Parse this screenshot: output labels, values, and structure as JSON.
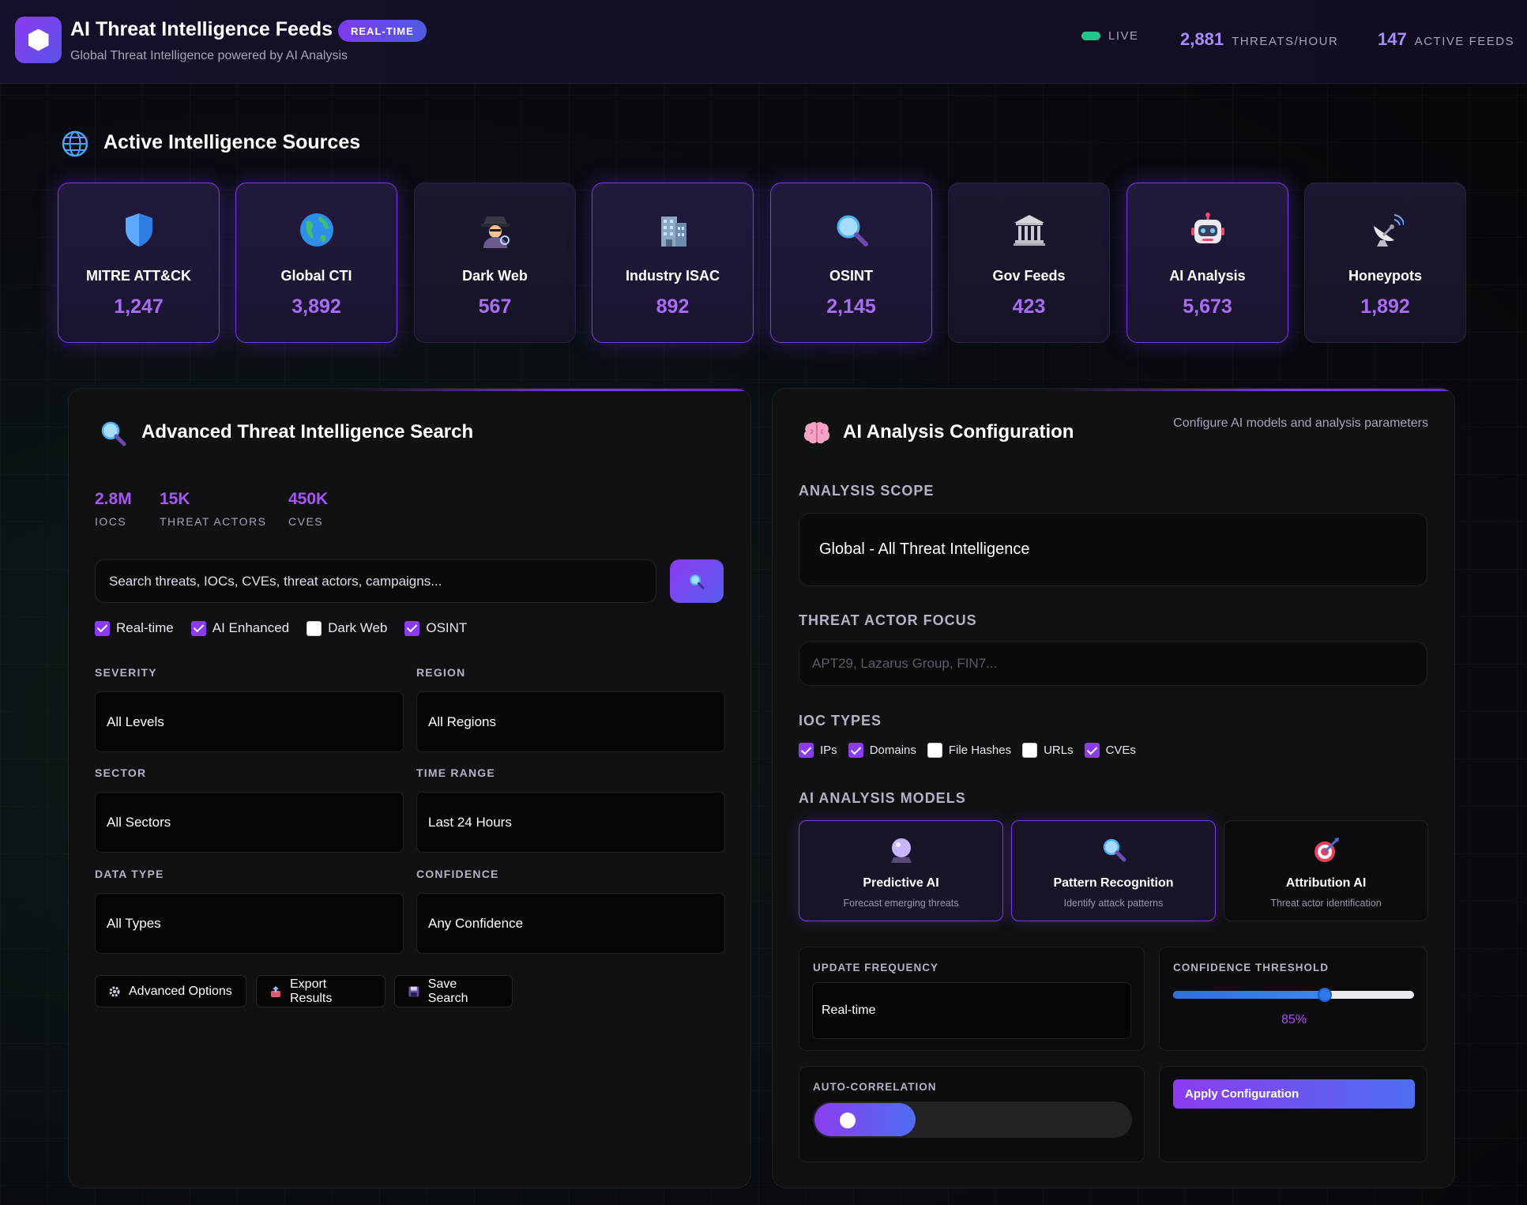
{
  "header": {
    "title": "AI Threat Intelligence Feeds",
    "badge": "REAL-TIME",
    "subtitle": "Global Threat Intelligence powered by AI Analysis",
    "live_label": "LIVE",
    "threats_value": "2,881",
    "threats_label": "THREATS/HOUR",
    "feeds_value": "147",
    "feeds_label": "ACTIVE FEEDS"
  },
  "sources": {
    "title": "Active Intelligence Sources",
    "items": [
      {
        "name": "MITRE ATT&CK",
        "value": "1,247",
        "icon": "shield-icon",
        "active": true
      },
      {
        "name": "Global CTI",
        "value": "3,892",
        "icon": "globe-icon",
        "active": true
      },
      {
        "name": "Dark Web",
        "value": "567",
        "icon": "detective-icon",
        "active": false
      },
      {
        "name": "Industry ISAC",
        "value": "892",
        "icon": "office-building-icon",
        "active": true
      },
      {
        "name": "OSINT",
        "value": "2,145",
        "icon": "magnifier-icon",
        "active": true
      },
      {
        "name": "Gov Feeds",
        "value": "423",
        "icon": "government-building-icon",
        "active": false
      },
      {
        "name": "AI Analysis",
        "value": "5,673",
        "icon": "robot-icon",
        "active": true
      },
      {
        "name": "Honeypots",
        "value": "1,892",
        "icon": "satellite-dish-icon",
        "active": false
      }
    ]
  },
  "search_panel": {
    "title": "Advanced Threat Intelligence Search",
    "stats": [
      {
        "value": "2.8M",
        "label": "IOCS"
      },
      {
        "value": "15K",
        "label": "THREAT ACTORS"
      },
      {
        "value": "450K",
        "label": "CVES"
      }
    ],
    "search_value": "Search threats, IOCs, CVEs, threat actors, campaigns...",
    "options": [
      {
        "label": "Real-time",
        "checked": true
      },
      {
        "label": "AI Enhanced",
        "checked": true
      },
      {
        "label": "Dark Web",
        "checked": false
      },
      {
        "label": "OSINT",
        "checked": true
      }
    ],
    "filters": {
      "severity": {
        "label": "SEVERITY",
        "value": "All Levels"
      },
      "region": {
        "label": "REGION",
        "value": "All Regions"
      },
      "sector": {
        "label": "SECTOR",
        "value": "All Sectors"
      },
      "time_range": {
        "label": "TIME RANGE",
        "value": "Last 24 Hours"
      },
      "data_type": {
        "label": "DATA TYPE",
        "value": "All Types"
      },
      "confidence": {
        "label": "CONFIDENCE",
        "value": "Any Confidence"
      }
    },
    "buttons": {
      "advanced": "Advanced Options",
      "export": "Export Results",
      "save": "Save Search"
    }
  },
  "config_panel": {
    "title": "AI Analysis Configuration",
    "subtitle": "Configure AI models and analysis parameters",
    "scope_label": "ANALYSIS SCOPE",
    "scope_value": "Global - All Threat Intelligence",
    "actor_label": "THREAT ACTOR FOCUS",
    "actor_placeholder": "APT29, Lazarus Group, FIN7...",
    "ioc_label": "IOC TYPES",
    "ioc_types": [
      {
        "label": "IPs",
        "checked": true
      },
      {
        "label": "Domains",
        "checked": true
      },
      {
        "label": "File Hashes",
        "checked": false
      },
      {
        "label": "URLs",
        "checked": false
      },
      {
        "label": "CVEs",
        "checked": true
      }
    ],
    "models_label": "AI ANALYSIS MODELS",
    "models": [
      {
        "title": "Predictive AI",
        "desc": "Forecast emerging threats",
        "icon": "crystal-ball-icon",
        "selected": true
      },
      {
        "title": "Pattern Recognition",
        "desc": "Identify attack patterns",
        "icon": "magnifier-icon",
        "selected": true
      },
      {
        "title": "Attribution AI",
        "desc": "Threat actor identification",
        "icon": "target-icon",
        "selected": false
      }
    ],
    "update_label": "UPDATE FREQUENCY",
    "update_value": "Real-time",
    "threshold_label": "CONFIDENCE THRESHOLD",
    "threshold_value": "85%",
    "threshold_fraction": 0.63,
    "autocorr_label": "AUTO-CORRELATION",
    "apply_label": "Apply Configuration"
  },
  "colors": {
    "accent": "#8b3cf0",
    "accent_secondary": "#5b5cf0",
    "value_purple": "#a86cf5",
    "live_green": "#22c58b"
  }
}
